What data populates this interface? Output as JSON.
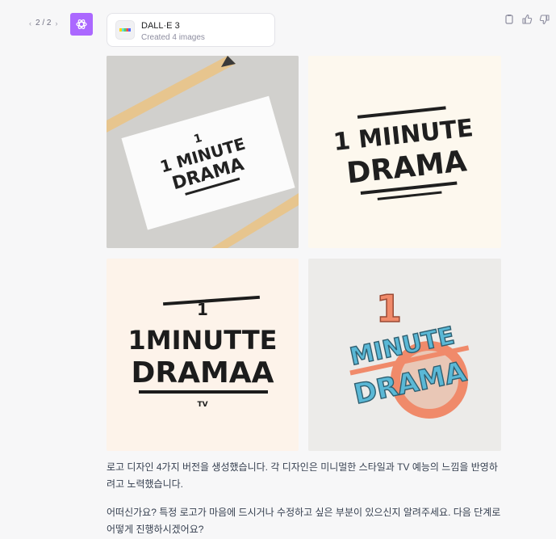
{
  "pager": {
    "label": "2 / 2"
  },
  "tool": {
    "name": "DALL·E 3",
    "status": "Created 4 images"
  },
  "images": [
    {
      "lines": [
        "1",
        "1 MINUTE",
        "DRAMA"
      ]
    },
    {
      "lines": [
        "1 MIINUTE",
        "DRAMA"
      ]
    },
    {
      "lines": [
        "1",
        "1MINUTTE",
        "DRAMAA",
        "TV"
      ]
    },
    {
      "lines": [
        "1",
        "MINUTE",
        "DRAMA"
      ]
    }
  ],
  "message": {
    "paragraph1": "로고 디자인 4가지 버전을 생성했습니다. 각 디자인은 미니멀한 스타일과 TV 예능의 느낌을 반영하려고 노력했습니다.",
    "paragraph2": "어떠신가요? 특정 로고가 마음에 드시거나 수정하고 싶은 부분이 있으신지 알려주세요. 다음 단계로 어떻게 진행하시겠어요?"
  },
  "colors": {
    "avatar": "#ab68ff",
    "background": "#f7f7f8",
    "accent_orange": "#f08a6a",
    "accent_teal": "#5ab8d6"
  },
  "icons": [
    "chevron-left-icon",
    "chevron-right-icon",
    "openai-logo-icon",
    "copy-icon",
    "thumbs-up-icon",
    "thumbs-down-icon"
  ]
}
